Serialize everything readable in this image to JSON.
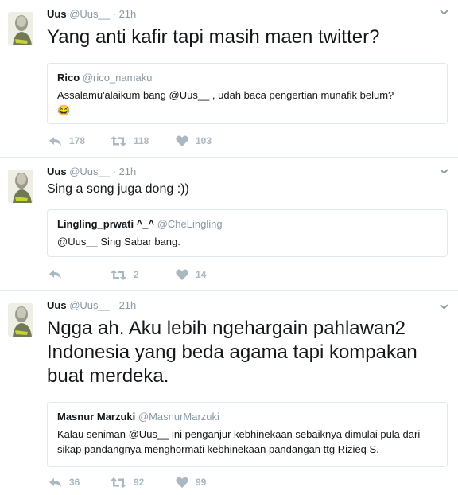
{
  "tweets": [
    {
      "name": "Uus",
      "handle": "@Uus__",
      "dot": "·",
      "time": "21h",
      "text": "Yang anti kafir tapi masih maen twitter?",
      "quote": {
        "name": "Rico",
        "handle": "@rico_namaku",
        "text": "Assalamu'alaikum bang @Uus__ , udah baca pengertian munafik belum?",
        "emoji": "😂"
      },
      "replies": "178",
      "retweets": "118",
      "likes": "103"
    },
    {
      "name": "Uus",
      "handle": "@Uus__",
      "dot": "·",
      "time": "21h",
      "text": "Sing a song juga dong :))",
      "quote": {
        "name": "Lingling_prwati ^_^",
        "handle": "@CheLingling",
        "text": "@Uus__ Sing Sabar bang."
      },
      "replies": "",
      "retweets": "2",
      "likes": "14"
    },
    {
      "name": "Uus",
      "handle": "@Uus__",
      "dot": "·",
      "time": "21h",
      "text": "Ngga ah. Aku lebih ngehargain pahlawan2 Indonesia yang beda agama tapi kompakan buat merdeka.",
      "quote": {
        "name": "Masnur Marzuki",
        "handle": "@MasnurMarzuki",
        "text": "Kalau seniman @Uus__ ini penganjur kebhinekaan sebaiknya dimulai pula dari sikap pandangnya menghormati kebhinekaan pandangan ttg Rizieq S."
      },
      "replies": "36",
      "retweets": "92",
      "likes": "99"
    }
  ],
  "icons": {
    "reply": "reply-icon",
    "retweet": "retweet-icon",
    "like": "heart-icon",
    "caret": "chevron-down-icon"
  },
  "colors": {
    "text": "#14171a",
    "muted": "#8899a6",
    "action": "#aab8c2",
    "border": "#e1e8ed"
  }
}
